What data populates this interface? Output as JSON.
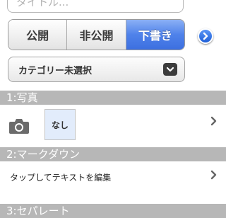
{
  "title_field": {
    "placeholder": "タイトル...",
    "value": ""
  },
  "status_segment": {
    "options": [
      "公開",
      "非公開",
      "下書き"
    ],
    "selected": "下書き",
    "accent_color": "#3c6fe0"
  },
  "category": {
    "label": "カテゴリー未選択"
  },
  "sections": {
    "photo": {
      "header": "1:写真",
      "thumbnail_text": "なし"
    },
    "markdown": {
      "header": "2:マークダウン",
      "prompt": "タップしてテキストを編集"
    },
    "separator": {
      "header": "3:セパレート"
    }
  },
  "icons": {
    "disclosure": "chevron-right-circle-icon",
    "camera": "camera-icon",
    "select_arrow": "chevron-down-icon",
    "row_chevron": "chevron-right-icon"
  }
}
